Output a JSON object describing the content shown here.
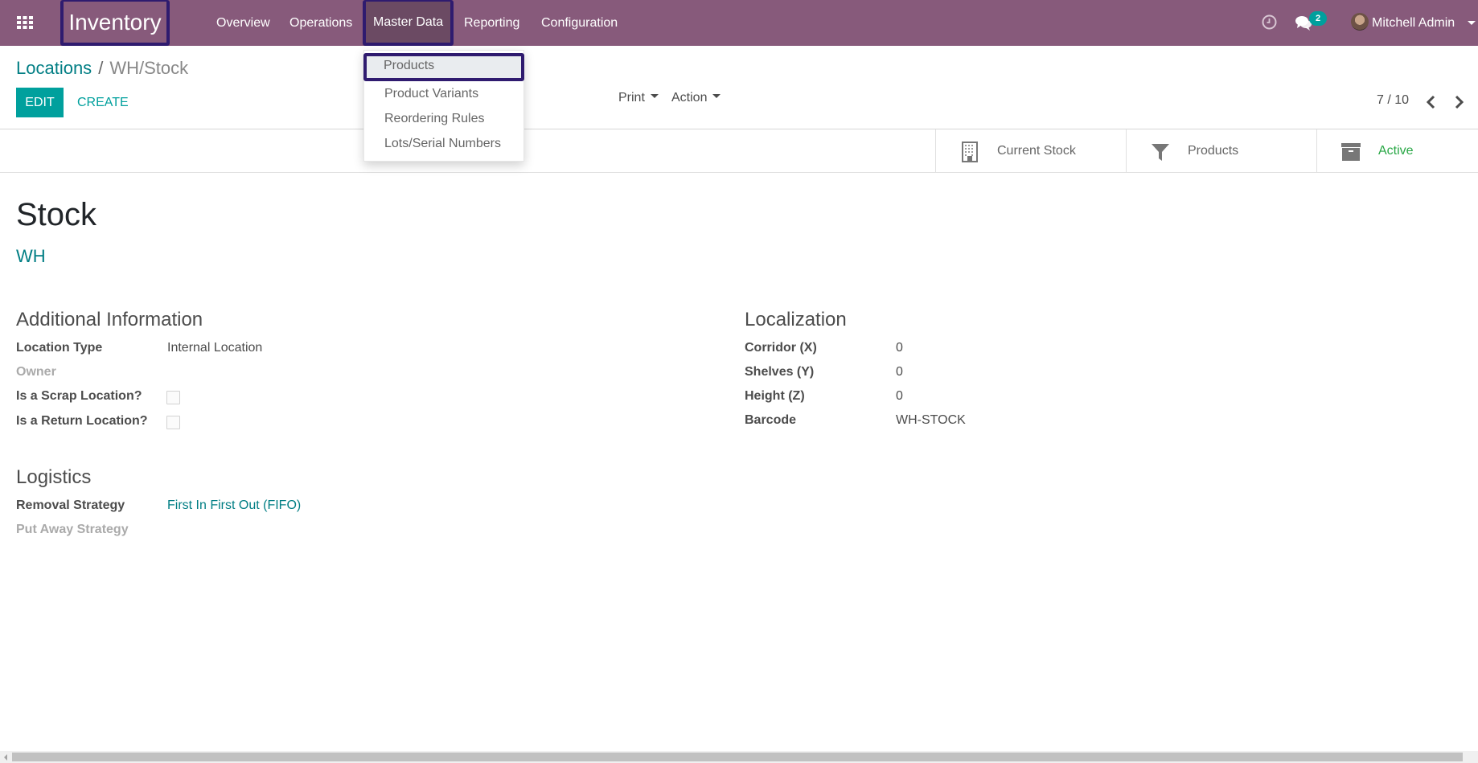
{
  "navbar": {
    "app_name": "Inventory",
    "menu": [
      {
        "label": "Overview"
      },
      {
        "label": "Operations"
      },
      {
        "label": "Master Data"
      },
      {
        "label": "Reporting"
      },
      {
        "label": "Configuration"
      }
    ],
    "messages_badge": "2",
    "user_name": "Mitchell Admin",
    "icons": {
      "apps": "apps-grid-icon",
      "activity": "clock-icon",
      "messages": "chat-icon"
    }
  },
  "master_data_menu": {
    "items": [
      {
        "label": "Products"
      },
      {
        "label": "Product Variants"
      },
      {
        "label": "Reordering Rules"
      },
      {
        "label": "Lots/Serial Numbers"
      }
    ],
    "highlighted": "Products"
  },
  "control_panel": {
    "breadcrumb": [
      {
        "label": "Locations"
      },
      {
        "label": "WH/Stock"
      }
    ],
    "breadcrumb_separator": "/",
    "edit_label": "EDIT",
    "create_label": "CREATE",
    "print_label": "Print",
    "action_label": "Action",
    "pager": "7 / 10"
  },
  "button_box": [
    {
      "label": "Current Stock",
      "icon": "building-icon"
    },
    {
      "label": "Products",
      "icon": "filter-icon"
    },
    {
      "label": "Active",
      "icon": "archive-icon"
    }
  ],
  "colors": {
    "navbar": "#875A7B",
    "primary": "#00A09D",
    "link": "#017e84",
    "active_status": "#28a745",
    "highlight_border": "#2f1b6f"
  },
  "record": {
    "name": "Stock",
    "parent": "WH",
    "additional_information": {
      "title": "Additional Information",
      "fields": [
        {
          "label": "Location Type",
          "value": "Internal Location"
        },
        {
          "label": "Owner",
          "value": ""
        },
        {
          "label": "Is a Scrap Location?",
          "value": false
        },
        {
          "label": "Is a Return Location?",
          "value": false
        }
      ]
    },
    "localization": {
      "title": "Localization",
      "fields": [
        {
          "label": "Corridor (X)",
          "value": "0"
        },
        {
          "label": "Shelves (Y)",
          "value": "0"
        },
        {
          "label": "Height (Z)",
          "value": "0"
        },
        {
          "label": "Barcode",
          "value": "WH-STOCK"
        }
      ]
    },
    "logistics": {
      "title": "Logistics",
      "fields": [
        {
          "label": "Removal Strategy",
          "value": "First In First Out (FIFO)"
        },
        {
          "label": "Put Away Strategy",
          "value": ""
        }
      ]
    }
  }
}
